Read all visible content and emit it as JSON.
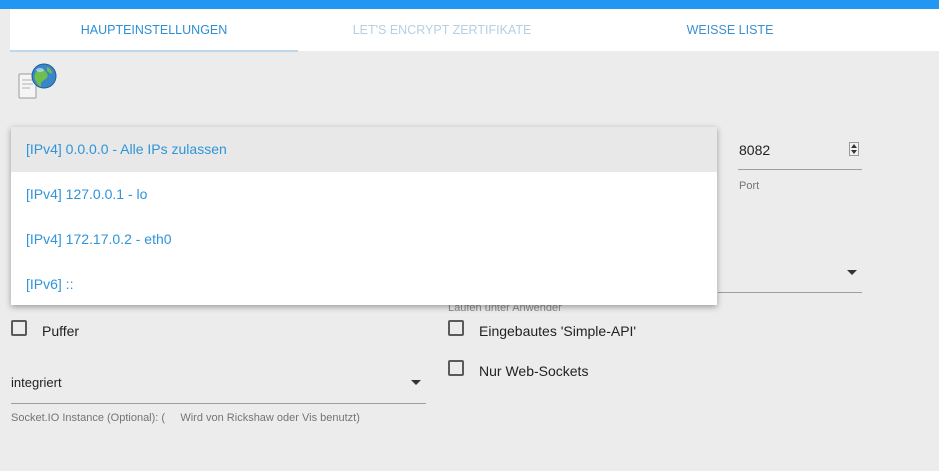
{
  "tabs": [
    {
      "label": "HAUPTEINSTELLUNGEN",
      "state": "active"
    },
    {
      "label": "LET'S ENCRYPT ZERTIFIKATE",
      "state": "disabled"
    },
    {
      "label": "WEISSE LISTE",
      "state": "normal"
    }
  ],
  "logo_icon": "web-adapter-logo-icon",
  "ip_dropdown": {
    "options": [
      "[IPv4] 0.0.0.0 - Alle IPs zulassen",
      "[IPv4] 127.0.0.1 - lo",
      "[IPv4] 172.17.0.2 - eth0",
      "[IPv6] ::"
    ],
    "selected_index": 0
  },
  "port": {
    "value": "8082",
    "label": "Port"
  },
  "run_as": {
    "label": "Laufen unter Anwender"
  },
  "checkboxes": {
    "puffer": {
      "label": "Puffer",
      "checked": false
    },
    "simple_api": {
      "label": "Eingebautes 'Simple-API'",
      "checked": false
    },
    "web_sockets": {
      "label": "Nur Web-Sockets",
      "checked": false
    }
  },
  "socket_io": {
    "value": "integriert",
    "label": "Socket.IO Instance (Optional): (     Wird von Rickshaw oder Vis benutzt)"
  },
  "colors": {
    "accent": "#2196f3",
    "link": "#2f94d8"
  }
}
